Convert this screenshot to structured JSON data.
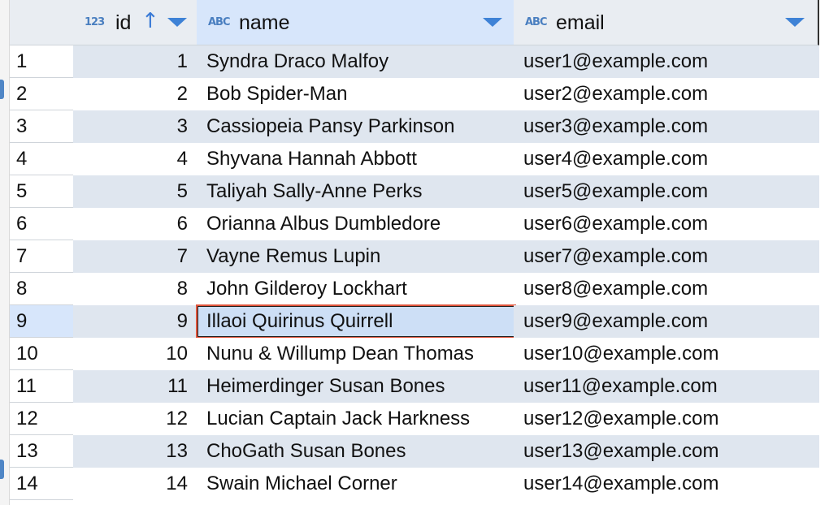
{
  "columns": [
    {
      "key": "id",
      "type_icon": "123",
      "title": "id",
      "sort": "↑"
    },
    {
      "key": "name",
      "type_icon": "ABC",
      "title": "name"
    },
    {
      "key": "email",
      "type_icon": "ABC",
      "title": "email"
    }
  ],
  "rows": [
    {
      "num": "1",
      "id": "1",
      "name": "Syndra Draco Malfoy",
      "email": "user1@example.com"
    },
    {
      "num": "2",
      "id": "2",
      "name": "Bob Spider-Man",
      "email": "user2@example.com"
    },
    {
      "num": "3",
      "id": "3",
      "name": "Cassiopeia Pansy Parkinson",
      "email": "user3@example.com"
    },
    {
      "num": "4",
      "id": "4",
      "name": "Shyvana Hannah Abbott",
      "email": "user4@example.com"
    },
    {
      "num": "5",
      "id": "5",
      "name": "Taliyah Sally-Anne Perks",
      "email": "user5@example.com"
    },
    {
      "num": "6",
      "id": "6",
      "name": "Orianna Albus Dumbledore",
      "email": "user6@example.com"
    },
    {
      "num": "7",
      "id": "7",
      "name": "Vayne Remus Lupin",
      "email": "user7@example.com"
    },
    {
      "num": "8",
      "id": "8",
      "name": "John Gilderoy Lockhart",
      "email": "user8@example.com"
    },
    {
      "num": "9",
      "id": "9",
      "name": "Illaoi Quirinus Quirrell",
      "email": "user9@example.com"
    },
    {
      "num": "10",
      "id": "10",
      "name": "Nunu & Willump Dean Thomas",
      "email": "user10@example.com"
    },
    {
      "num": "11",
      "id": "11",
      "name": "Heimerdinger Susan Bones",
      "email": "user11@example.com"
    },
    {
      "num": "12",
      "id": "12",
      "name": "Lucian Captain Jack Harkness",
      "email": "user12@example.com"
    },
    {
      "num": "13",
      "id": "13",
      "name": "ChoGath Susan Bones",
      "email": "user13@example.com"
    },
    {
      "num": "14",
      "id": "14",
      "name": "Swain Michael Corner",
      "email": "user14@example.com"
    }
  ],
  "selected_row": "9",
  "selected_column": "name",
  "colors": {
    "accent": "#3e82d6",
    "selection_outline": "#e0553c",
    "row_stripe": "#dfe6ef",
    "current_row": "#d7e6fb"
  }
}
